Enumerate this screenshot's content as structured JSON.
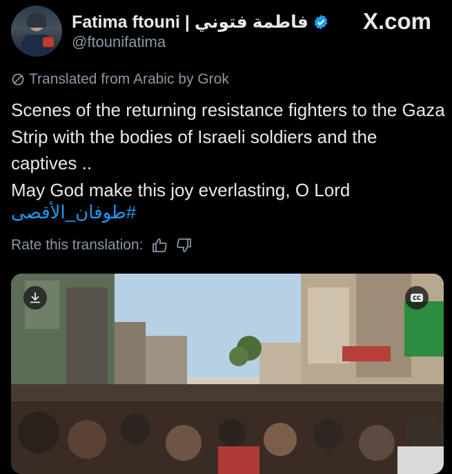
{
  "author": {
    "display_name": "Fatima ftouni | فاطمة فتوني",
    "handle": "@ftounifatima"
  },
  "site_label": "X.com",
  "translation": {
    "notice": "Translated from Arabic by Grok",
    "rate_label": "Rate this translation:"
  },
  "tweet": {
    "lines": [
      "Scenes of the returning resistance fighters to the Gaza Strip with the bodies of Israeli soldiers and the captives ..",
      "May God make this joy everlasting, O Lord"
    ],
    "hashtag": "#طوفان_الأقصى"
  },
  "media": {
    "caption_badge": "CC"
  },
  "colors": {
    "background": "#000000",
    "text": "#e7e9ea",
    "muted": "#8b98a5",
    "link": "#1d9bf0",
    "verified": "#1d9bf0"
  },
  "icons": [
    "verified-icon",
    "translate-icon",
    "thumbs-up-icon",
    "thumbs-down-icon",
    "download-icon",
    "closed-captions-icon"
  ]
}
